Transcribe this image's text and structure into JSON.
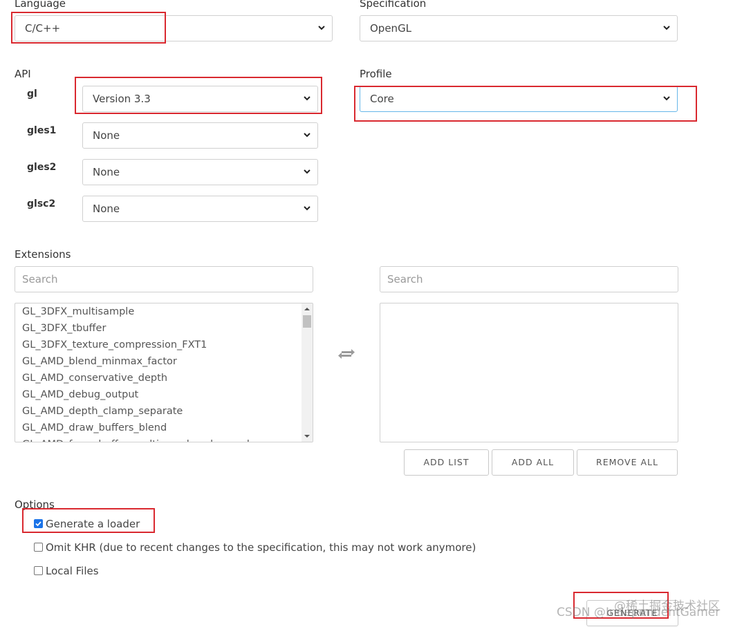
{
  "language": {
    "label": "Language",
    "value": "C/C++"
  },
  "specification": {
    "label": "Specification",
    "value": "OpenGL"
  },
  "api": {
    "label": "API",
    "rows": [
      {
        "name": "gl",
        "value": "Version 3.3"
      },
      {
        "name": "gles1",
        "value": "None"
      },
      {
        "name": "gles2",
        "value": "None"
      },
      {
        "name": "glsc2",
        "value": "None"
      }
    ]
  },
  "profile": {
    "label": "Profile",
    "value": "Core"
  },
  "extensions": {
    "label": "Extensions",
    "search_left_placeholder": "Search",
    "search_right_placeholder": "Search",
    "available": [
      "GL_3DFX_multisample",
      "GL_3DFX_tbuffer",
      "GL_3DFX_texture_compression_FXT1",
      "GL_AMD_blend_minmax_factor",
      "GL_AMD_conservative_depth",
      "GL_AMD_debug_output",
      "GL_AMD_depth_clamp_separate",
      "GL_AMD_draw_buffers_blend",
      "GL_AMD_framebuffer_multisample_advanced"
    ],
    "buttons": {
      "add_list": "ADD LIST",
      "add_all": "ADD ALL",
      "remove_all": "REMOVE ALL"
    }
  },
  "options": {
    "label": "Options",
    "items": [
      {
        "label": "Generate a loader",
        "checked": true
      },
      {
        "label": "Omit KHR (due to recent changes to the specification, this may not work anymore)",
        "checked": false
      },
      {
        "label": "Local Files",
        "checked": false
      }
    ]
  },
  "generate_label": "GENERATE",
  "watermark": {
    "line1": "@稀土掘金技术社区",
    "line2": "CSDN @IndependentGamer"
  },
  "colors": {
    "highlight": "#d9282f",
    "focus": "#66b6e8",
    "checkbox": "#1a73e8"
  }
}
